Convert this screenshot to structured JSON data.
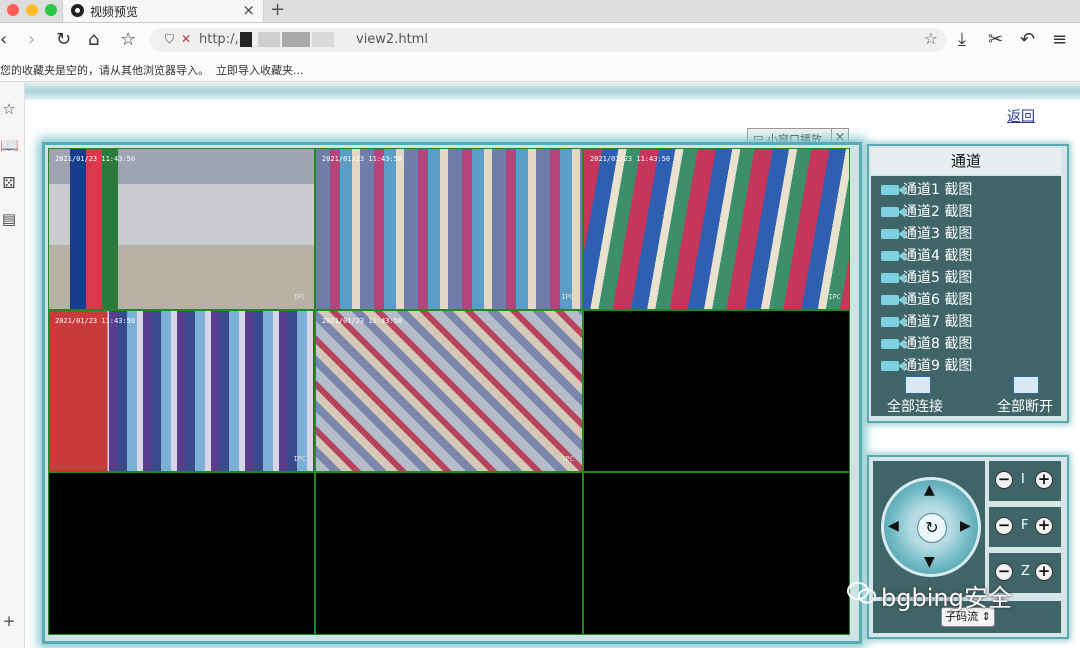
{
  "browser": {
    "tab_title": "视频预览",
    "tab_close": "×",
    "new_tab": "+",
    "url_prefix": "http:/,",
    "url_suffix": "view2.html",
    "bookmarks_message": "您的收藏夹是空的，请从其他浏览器导入。",
    "bookmarks_import_link": "立即导入收藏夹..."
  },
  "page": {
    "back_link": "返回",
    "pip_button": "小窗口播放",
    "pip_close": "×",
    "cameras": [
      {
        "timestamp": "2021/01/23 11:43:50",
        "label": "IPC"
      },
      {
        "timestamp": "2021/01/23 11:43:50",
        "label": "IPC"
      },
      {
        "timestamp": "2021/01/23 11:43:50",
        "label": "IPC"
      },
      {
        "timestamp": "2021/01/23 11:43:50",
        "label": "IPC"
      },
      {
        "timestamp": "2021/01/23 11:43:50",
        "label": "IPC"
      }
    ],
    "channels": {
      "title": "通道",
      "items": [
        {
          "label": "通道1 截图"
        },
        {
          "label": "通道2 截图"
        },
        {
          "label": "通道3 截图"
        },
        {
          "label": "通道4 截图"
        },
        {
          "label": "通道5 截图"
        },
        {
          "label": "通道6 截图"
        },
        {
          "label": "通道7 截图"
        },
        {
          "label": "通道8 截图"
        },
        {
          "label": "通道9 截图"
        }
      ],
      "connect_all": "全部连接",
      "disconnect_all": "全部断开"
    },
    "ptz": {
      "iris_label": "I",
      "focus_label": "F",
      "zoom_label": "Z",
      "minus": "−",
      "plus": "+",
      "stream_select": "子码流"
    }
  },
  "watermark": "bgbing安全",
  "colors": {
    "frame_border": "#55aab3",
    "panel_bg": "#3f6568",
    "grid_line": "#1f8a1f",
    "link": "#2b3a99"
  }
}
